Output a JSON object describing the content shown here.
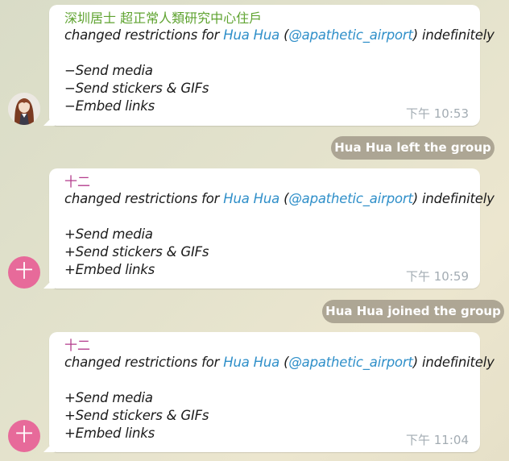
{
  "messages": [
    {
      "sender": "深圳居士 超正常人類研究中心住戶",
      "sender_color": "#5fa330",
      "avatar_letter": "",
      "action": "changed restrictions for ",
      "user_name": "Hua Hua",
      "user_handle": "@apathetic_airport",
      "suffix": " indefinitely",
      "lines": [
        "−Send media",
        "−Send stickers & GIFs",
        "−Embed links"
      ],
      "time": "下午 10:53"
    },
    {
      "sender": "十二",
      "sender_color": "#b33c8c",
      "avatar_letter": "十",
      "action": "changed restrictions for ",
      "user_name": "Hua Hua",
      "user_handle": "@apathetic_airport",
      "suffix": " indefinitely",
      "lines": [
        "+Send media",
        "+Send stickers & GIFs",
        "+Embed links"
      ],
      "time": "下午 10:59"
    },
    {
      "sender": "十二",
      "sender_color": "#b33c8c",
      "avatar_letter": "十",
      "action": "changed restrictions for ",
      "user_name": "Hua Hua",
      "user_handle": "@apathetic_airport",
      "suffix": " indefinitely",
      "lines": [
        "+Send media",
        "+Send stickers & GIFs",
        "+Embed links"
      ],
      "time": "下午 11:04"
    }
  ],
  "service": {
    "left": "Hua Hua left the group",
    "joined": "Hua Hua joined the group"
  },
  "colors": {
    "link": "#2f8fc9",
    "avatar_pink": "#e76a9a",
    "service_bg": "#968e7e"
  }
}
